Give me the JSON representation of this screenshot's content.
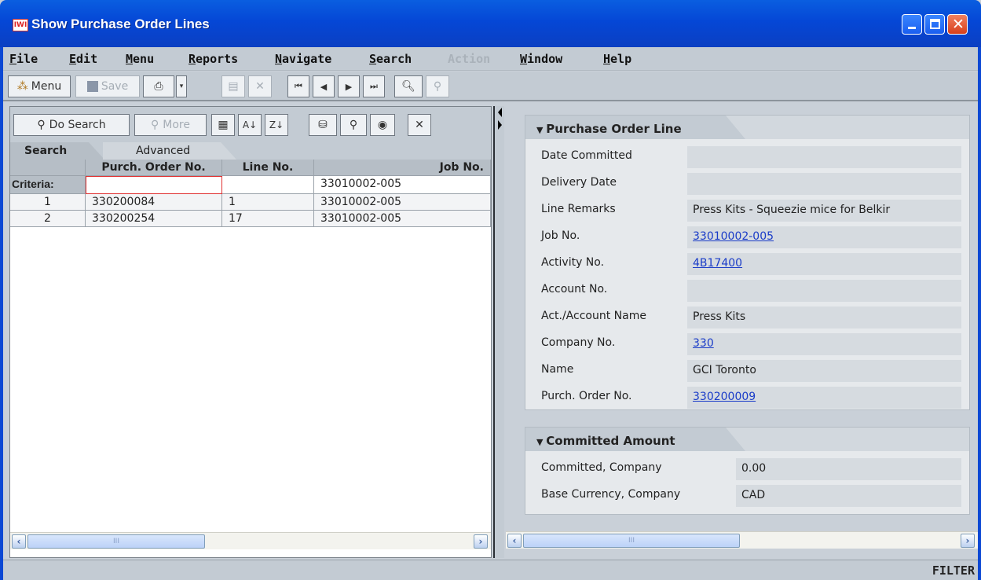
{
  "window": {
    "title": "Show Purchase Order Lines",
    "app_icon_text": "IWI"
  },
  "menubar": {
    "items": [
      {
        "label": "File",
        "underline": "F",
        "rest": "ile",
        "enabled": true
      },
      {
        "label": "Edit",
        "underline": "E",
        "rest": "dit",
        "enabled": true
      },
      {
        "label": "Menu",
        "underline": "M",
        "rest": "enu",
        "enabled": true
      },
      {
        "label": "Reports",
        "underline": "R",
        "rest": "eports",
        "enabled": true
      },
      {
        "label": "Navigate",
        "underline": "N",
        "rest": "avigate",
        "enabled": true
      },
      {
        "label": "Search",
        "underline": "S",
        "rest": "earch",
        "enabled": true
      },
      {
        "label": "Action",
        "underline": "",
        "rest": "Action",
        "enabled": false
      },
      {
        "label": "Window",
        "underline": "W",
        "rest": "indow",
        "enabled": true
      },
      {
        "label": "Help",
        "underline": "H",
        "rest": "elp",
        "enabled": true
      }
    ]
  },
  "toolbar": {
    "menu_label": "Menu",
    "save_label": "Save"
  },
  "search_toolbar": {
    "do_search_label": "Do Search",
    "more_label": "More"
  },
  "tabs": {
    "search": "Search",
    "advanced": "Advanced"
  },
  "grid": {
    "columns": [
      "Purch. Order No.",
      "Line No.",
      "Job No."
    ],
    "criteria_label": "Criteria:",
    "criteria": {
      "po": "",
      "line": "",
      "job": "33010002-005"
    },
    "rows": [
      {
        "num": "1",
        "po": "330200084",
        "line": "1",
        "job": "33010002-005"
      },
      {
        "num": "2",
        "po": "330200254",
        "line": "17",
        "job": "33010002-005"
      }
    ]
  },
  "po_line_section": {
    "title": "Purchase Order Line",
    "fields": [
      {
        "label": "Date Committed",
        "value": "",
        "link": false
      },
      {
        "label": "Delivery Date",
        "value": "",
        "link": false
      },
      {
        "label": "Line Remarks",
        "value": "Press Kits - Squeezie mice for Belkir",
        "link": false
      },
      {
        "label": "Job No.",
        "value": "33010002-005",
        "link": true
      },
      {
        "label": "Activity No.",
        "value": "4B17400",
        "link": true
      },
      {
        "label": "Account No.",
        "value": "",
        "link": false
      },
      {
        "label": "Act./Account Name",
        "value": "Press Kits",
        "link": false
      },
      {
        "label": "Company No.",
        "value": "330",
        "link": true
      },
      {
        "label": "Name",
        "value": "GCI Toronto",
        "link": false
      },
      {
        "label": "Purch. Order No.",
        "value": "330200009",
        "link": true
      }
    ]
  },
  "committed_section": {
    "title": "Committed Amount",
    "fields": [
      {
        "label": "Committed, Company",
        "value": "0.00"
      },
      {
        "label": "Base Currency, Company",
        "value": "CAD"
      }
    ]
  },
  "statusbar": {
    "mode": "FILTER"
  },
  "scrollbar": {
    "thumb_grip": "III"
  }
}
